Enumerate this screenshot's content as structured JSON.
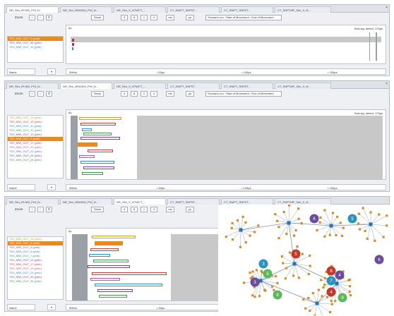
{
  "tabs": [
    "NR_Sim_IR.NW_PHI_N...",
    "NR_Sim_NRASIM_PHI_N...",
    "NR_Sim_X_NTWCT_...",
    "CT_SNIPT_SNPST...",
    "CT_SNIPT_SNPST...",
    "CT_SNPTMP_Sim_X_N..."
  ],
  "toolbar": {
    "zoom_label": "Zoom",
    "btn_zoom_in": "+",
    "btn_zoom_out": "−",
    "btn_fit": "⊡",
    "show_label": "Show",
    "fields": [
      "3",
      "8",
      "1",
      "4",
      "ms",
      "μs"
    ],
    "scenario": "Scenario run : Start of Movement - End of Movement"
  },
  "panels": [
    {
      "signals": [
        {
          "name": "TEX_MW_OUT_0 (ymb)",
          "color": "#ffffff",
          "selected": true
        },
        {
          "name": "TEX_MW_OUT_46 (ymb)",
          "color": "#7a3fa0",
          "selected": false
        },
        {
          "name": "TEX_MW_OUT_11 (ymb)",
          "color": "#2c8fd4",
          "selected": false
        }
      ],
      "final_label": "final sig. detect: 175μs",
      "zero_label": "0μ",
      "ruler": [
        "0Mms",
        "• 50μs",
        "• 100μs",
        "• 150μs"
      ],
      "name_label": "Name",
      "dropdown": "▾"
    },
    {
      "signals": [
        {
          "name": "TEX_MW_OUT_15 (ymb)",
          "color": "#d4a020",
          "selected": false
        },
        {
          "name": "TEX_MW_OUT_10 (ymb)",
          "color": "#cc4040",
          "selected": false
        },
        {
          "name": "TEX_MW_OUT_11 (ymb)",
          "color": "#2c8fd4",
          "selected": false
        },
        {
          "name": "TEX_MW_OUT_12 (ymb)",
          "color": "#3aa34a",
          "selected": false
        },
        {
          "name": "TEX_MW_OUT_13 (ymb)",
          "color": "#7a3fa0",
          "selected": false
        },
        {
          "name": "TEX_MW_OUT_0 (ymb)",
          "color": "#ffffff",
          "selected": true
        },
        {
          "name": "TEX_MW_OUT_17 (ymb)",
          "color": "#cc4040",
          "selected": false
        },
        {
          "name": "TEX_MW_OUT_19 (ymb)",
          "color": "#d050a0",
          "selected": false
        },
        {
          "name": "TEX_MW_OUT_20 (ymb)",
          "color": "#2c8fd4",
          "selected": false
        },
        {
          "name": "TEX_MW_OUT_25 (ymb)",
          "color": "#7a3fa0",
          "selected": false
        },
        {
          "name": "TEX_MW_OUT_28 (ymb)",
          "color": "#3aa34a",
          "selected": false
        }
      ],
      "final_label": "final sig. detect: 175μs",
      "zero_label": "0μ",
      "ruler": [
        "0Mms",
        "• 50μs",
        "• 100μs",
        "• 150μs"
      ],
      "name_label": "Name",
      "dropdown": "▾"
    },
    {
      "signals": [
        {
          "name": "TEX_MW_OUT_15 (ymb)",
          "color": "#d4a020",
          "selected": false
        },
        {
          "name": "TEX_MW_OUT_0 (ymb)",
          "color": "#ffffff",
          "selected": true
        },
        {
          "name": "TEX_MW_OUT_4 (ymb)",
          "color": "#cc4040",
          "selected": false
        },
        {
          "name": "TEX_MW_OUT_5 (ymb)",
          "color": "#2c8fd4",
          "selected": false
        },
        {
          "name": "TEX_MW_OUT_7 (ymb)",
          "color": "#3aa34a",
          "selected": false
        },
        {
          "name": "TEX_MW_OUT_13 (ymb)",
          "color": "#7a3fa0",
          "selected": false
        },
        {
          "name": "TEX_MW_OUT_17 (ymb)",
          "color": "#cc4040",
          "selected": false
        },
        {
          "name": "TEX_MW_OUT_19 (ymb)",
          "color": "#d050a0",
          "selected": false
        },
        {
          "name": "TEX_MW_OUT_24 (ymb)",
          "color": "#2c8fd4",
          "selected": false
        },
        {
          "name": "TEX_MW_OUT_25 (ymb)",
          "color": "#7a3fa0",
          "selected": false
        },
        {
          "name": "TEX_MW_OUT_28 (ymb)",
          "color": "#3aa34a",
          "selected": false
        }
      ],
      "zero_label": "0μ",
      "ruler": [
        "0Mms",
        "• 50μs"
      ],
      "name_label": "Name",
      "dropdown": "▾"
    }
  ],
  "graph": {
    "node_labels": [
      "6",
      "5",
      "6",
      "5",
      "3",
      "3",
      "8",
      "7",
      "4",
      "9",
      "4",
      "5",
      "8"
    ],
    "colors": {
      "hub": "#2a6fb0",
      "leaf": "#d98a2a",
      "edge": "#7a93ad",
      "purple": "#6a4c9c",
      "teal": "#2e93b8",
      "red": "#c0392b",
      "green": "#5cb85c"
    }
  }
}
